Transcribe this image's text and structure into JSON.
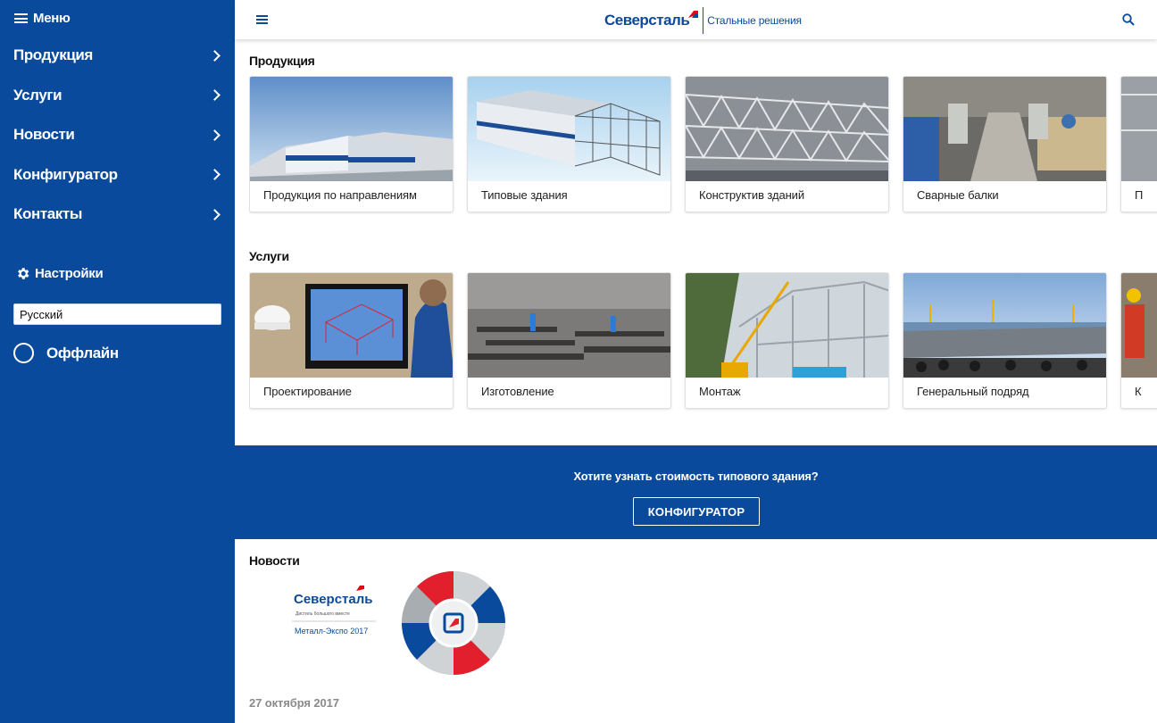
{
  "sidebar": {
    "menu_title": "Меню",
    "items": [
      {
        "label": "Продукция"
      },
      {
        "label": "Услуги"
      },
      {
        "label": "Новости"
      },
      {
        "label": "Конфигуратор"
      },
      {
        "label": "Контакты"
      }
    ],
    "settings_title": "Настройки",
    "language_value": "Русский",
    "offline_label": "Оффлайн"
  },
  "header": {
    "logo_main": "Северсталь",
    "logo_sub": "Стальные решения"
  },
  "products": {
    "title": "Продукция",
    "cards": [
      {
        "label": "Продукция по направлениям"
      },
      {
        "label": "Типовые здания"
      },
      {
        "label": "Конструктив зданий"
      },
      {
        "label": "Сварные балки"
      },
      {
        "label": "П"
      }
    ]
  },
  "services": {
    "title": "Услуги",
    "cards": [
      {
        "label": "Проектирование"
      },
      {
        "label": "Изготовление"
      },
      {
        "label": "Монтаж"
      },
      {
        "label": "Генеральный подряд"
      },
      {
        "label": "К"
      }
    ]
  },
  "cta": {
    "text": "Хотите узнать стоимость типового здания?",
    "button_label": "КОНФИГУРАТОР"
  },
  "news": {
    "title": "Новости",
    "image_logo": "Северсталь",
    "image_tagline": "Дистиль большого вместе",
    "image_event": "Металл-Экспо 2017",
    "date": "27 октября 2017"
  },
  "colors": {
    "brand_blue": "#0a4a9c",
    "brand_red": "#e30613",
    "text_dark": "#222222",
    "text_muted": "#8a8a8a"
  }
}
